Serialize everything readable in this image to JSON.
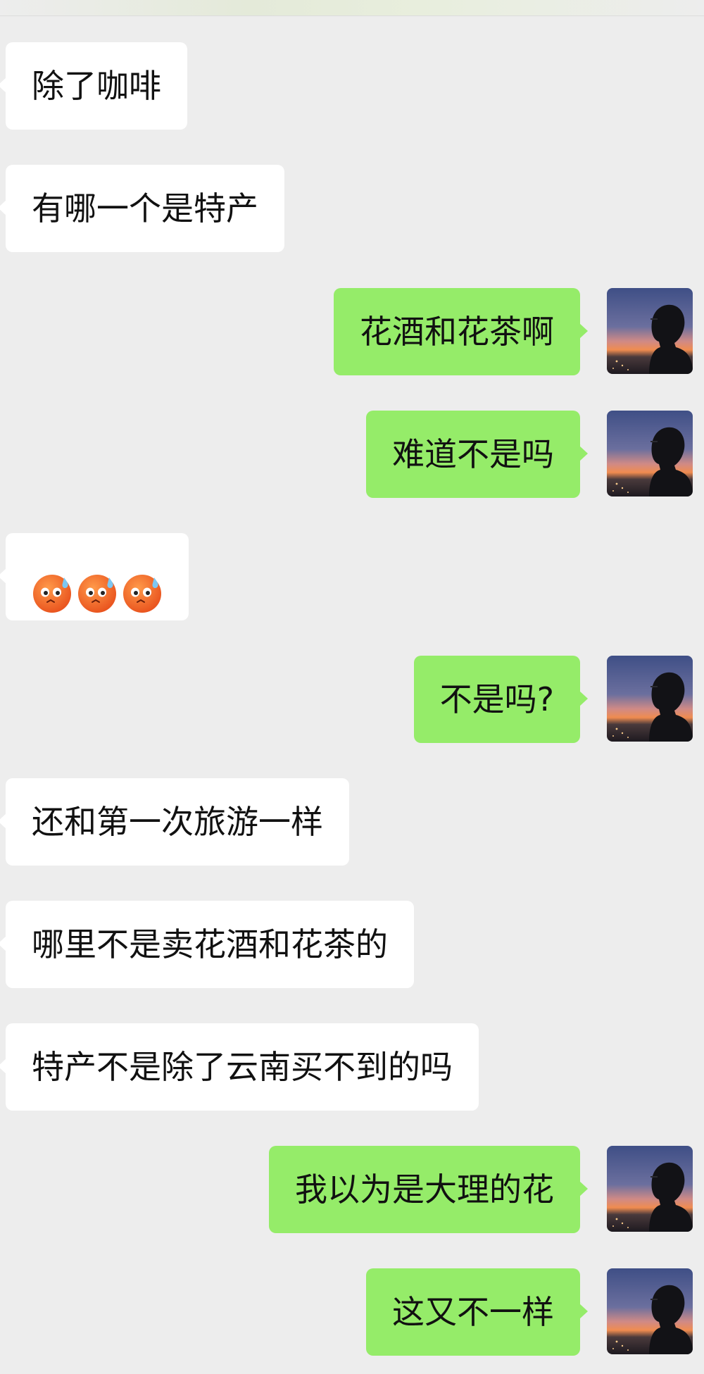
{
  "messages": [
    {
      "side": "left",
      "text": "除了咖啡"
    },
    {
      "side": "left",
      "text": "有哪一个是特产"
    },
    {
      "side": "right",
      "text": "花酒和花茶啊"
    },
    {
      "side": "right",
      "text": "难道不是吗"
    },
    {
      "side": "left",
      "emoji": "sweat-pouting-face",
      "emoji_count": 3
    },
    {
      "side": "right",
      "text": "不是吗?"
    },
    {
      "side": "left",
      "text": "还和第一次旅游一样"
    },
    {
      "side": "left",
      "text": "哪里不是卖花酒和花茶的"
    },
    {
      "side": "left",
      "text": "特产不是除了云南买不到的吗"
    },
    {
      "side": "right",
      "text": "我以为是大理的花"
    },
    {
      "side": "right",
      "text": "这又不一样"
    }
  ],
  "colors": {
    "background": "#ededed",
    "incoming_bubble": "#ffffff",
    "outgoing_bubble": "#95ec69",
    "text": "#111111"
  },
  "avatar": {
    "icon": "silhouette-at-sunset-avatar"
  }
}
